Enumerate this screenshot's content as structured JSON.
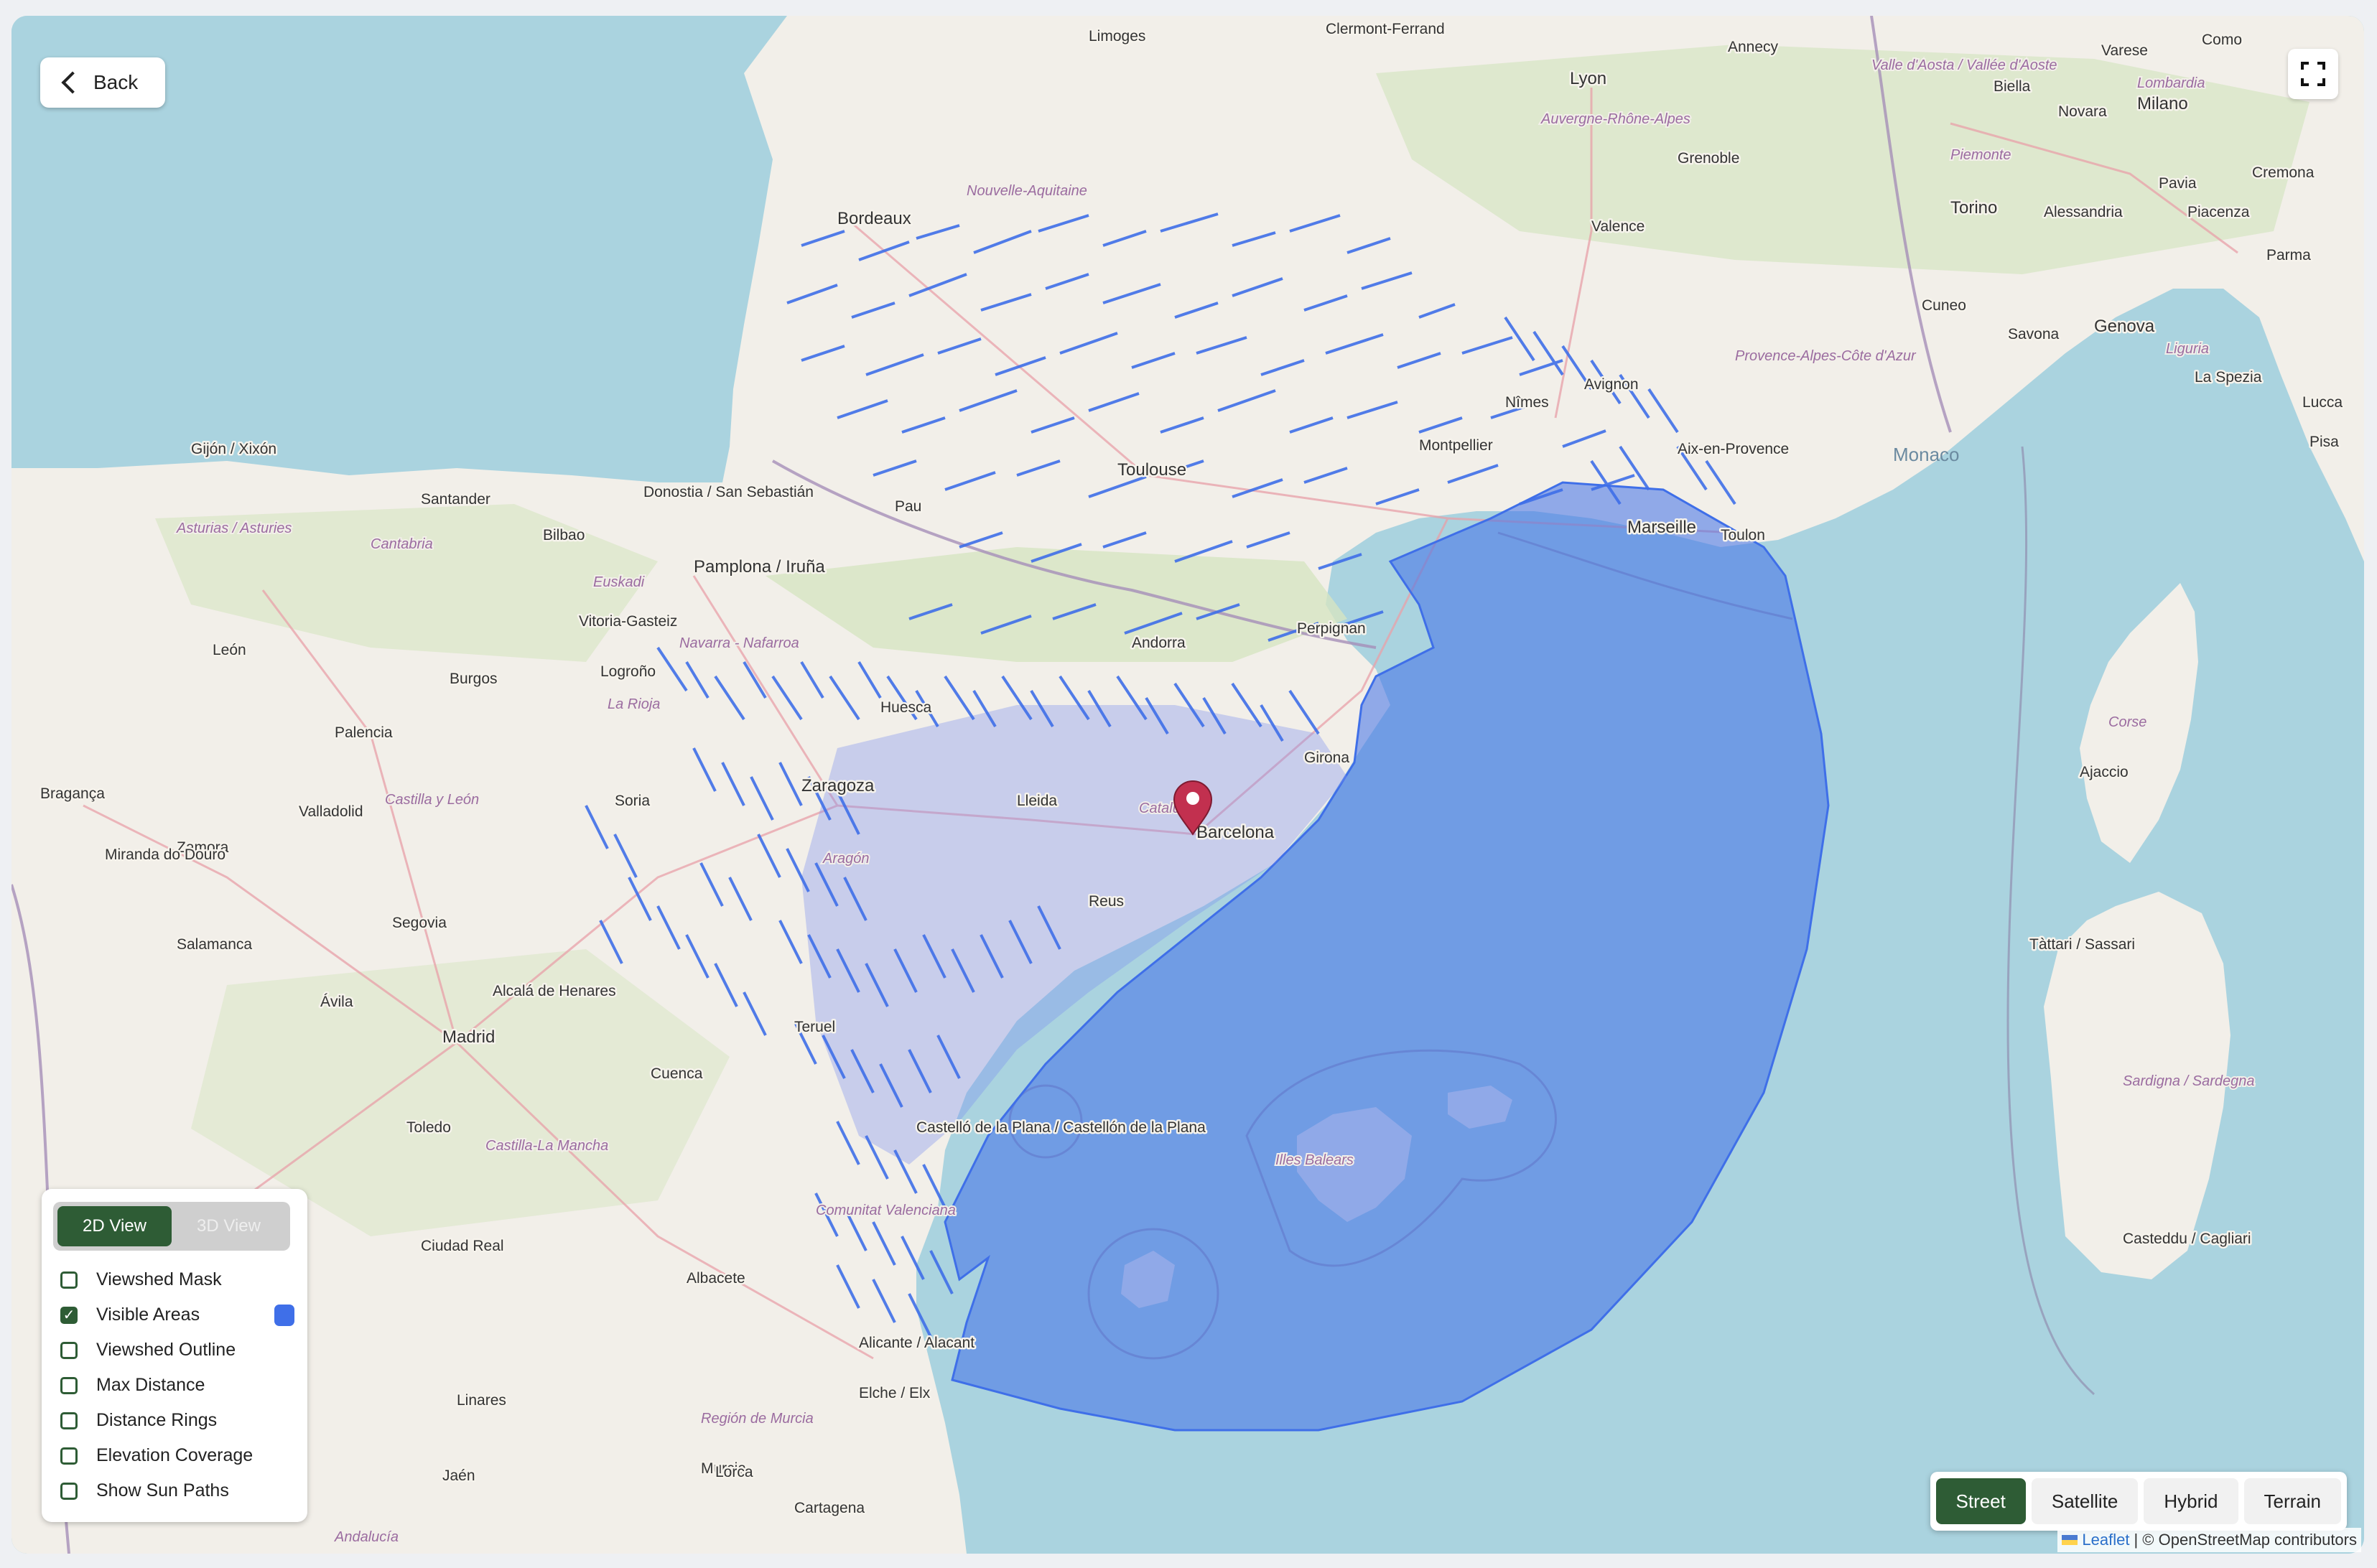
{
  "controls": {
    "back_label": "Back",
    "fullscreen_icon": "fullscreen-icon",
    "view_modes": [
      "2D View",
      "3D View"
    ],
    "active_view": "2D View",
    "layers": [
      {
        "label": "Viewshed Mask",
        "checked": false
      },
      {
        "label": "Visible Areas",
        "checked": true,
        "swatch": "#3f6fe8"
      },
      {
        "label": "Viewshed Outline",
        "checked": false
      },
      {
        "label": "Max Distance",
        "checked": false
      },
      {
        "label": "Distance Rings",
        "checked": false
      },
      {
        "label": "Elevation Coverage",
        "checked": false
      },
      {
        "label": "Show Sun Paths",
        "checked": false
      }
    ],
    "basemaps": [
      "Street",
      "Satellite",
      "Hybrid",
      "Terrain"
    ],
    "active_basemap": "Street"
  },
  "attribution": {
    "leaflet": "Leaflet",
    "rest": "| © OpenStreetMap contributors"
  },
  "colors": {
    "accent": "#2e5c35",
    "visible_area": "#3f6fe8",
    "sea": "#aad3df",
    "land": "#f2efe9",
    "marker": "#c2304f"
  },
  "map": {
    "cities": [
      "Limoges",
      "Clermont-Ferrand",
      "Annecy",
      "Como",
      "Varese",
      "Lyon",
      "Milano",
      "Biella",
      "Novara",
      "Bordeaux",
      "Grenoble",
      "Valence",
      "Torino",
      "Cremona",
      "Pavia",
      "Alessandria",
      "Piacenza",
      "Parma",
      "Cuneo",
      "Genova",
      "Savona",
      "La Spezia",
      "Lucca",
      "Pisa",
      "Avignon",
      "Nîmes",
      "Montpellier",
      "Aix-en-Provence",
      "Marseille",
      "Toulon",
      "Monaco",
      "Toulouse",
      "Pau",
      "Perpignan",
      "Andorra",
      "Gijón / Xixón",
      "Santander",
      "Bilbao",
      "Donostia / San Sebastián",
      "Pamplona / Iruña",
      "Vitoria-Gasteiz",
      "Logroño",
      "León",
      "Burgos",
      "Palencia",
      "Huesca",
      "Zaragoza",
      "Lleida",
      "Girona",
      "Barcelona",
      "Reus",
      "Bragança",
      "Valladolid",
      "Soria",
      "Zamora",
      "Miranda do Douro",
      "Salamanca",
      "Segovia",
      "Ávila",
      "Alcalá de Henares",
      "Madrid",
      "Teruel",
      "Cuenca",
      "Toledo",
      "Castelló de la Plana / Castellón de la Plana",
      "Ciudad Real",
      "Albacete",
      "Alicante / Alacant",
      "Elche / Elx",
      "Murcia",
      "Cartagena",
      "Linares",
      "Jaén",
      "Lorca",
      "Ajaccio",
      "Tàttari / Sassari",
      "Casteddu / Cagliari"
    ],
    "regions": [
      "Nouvelle-Aquitaine",
      "Auvergne-Rhône-Alpes",
      "Valle d'Aosta / Vallée d'Aoste",
      "Piemonte",
      "Lombardia",
      "Liguria",
      "Provence-Alpes-Côte d'Azur",
      "Asturias / Asturies",
      "Cantabria",
      "Euskadi",
      "Navarra - Nafarroa",
      "La Rioja",
      "Castilla y León",
      "Aragón",
      "Cataluña",
      "Castilla-La Mancha",
      "Comunitat Valenciana",
      "Región de Murcia",
      "Illes Balears",
      "Corse",
      "Sardigna / Sardegna",
      "Andalucía"
    ]
  }
}
